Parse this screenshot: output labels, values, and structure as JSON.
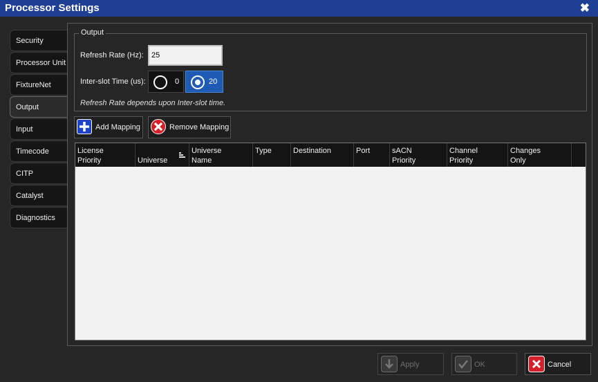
{
  "window": {
    "title": "Processor Settings",
    "close_glyph": "✖"
  },
  "sidebar": {
    "items": [
      {
        "label": "Security"
      },
      {
        "label": "Processor Unit"
      },
      {
        "label": "FixtureNet"
      },
      {
        "label": "Output",
        "active": true
      },
      {
        "label": "Input"
      },
      {
        "label": "Timecode"
      },
      {
        "label": "CITP"
      },
      {
        "label": "Catalyst"
      },
      {
        "label": "Diagnostics"
      }
    ]
  },
  "output": {
    "group_title": "Output",
    "refresh_rate_label": "Refresh Rate (Hz):",
    "refresh_rate_value": "25",
    "interslot_label": "Inter-slot Time (us):",
    "interslot_options": [
      {
        "value": "0",
        "selected": false
      },
      {
        "value": "20",
        "selected": true
      }
    ],
    "note": "Refresh Rate depends upon Inter-slot time."
  },
  "toolbar": {
    "add_mapping": "Add Mapping",
    "remove_mapping": "Remove Mapping"
  },
  "table": {
    "columns": [
      "License\nPriority",
      "Universe",
      "Universe\nName",
      "Type",
      "Destination",
      "Port",
      "sACN\nPriority",
      "Channel\nPriority",
      "Changes\nOnly"
    ],
    "sorted_column": "Universe",
    "rows": []
  },
  "footer": {
    "apply": "Apply",
    "ok": "OK",
    "cancel": "Cancel"
  },
  "colors": {
    "titlebar": "#1f3f94",
    "selected_radio": "#1e5bb4",
    "add_icon": "#1d44c5",
    "remove_icon": "#d51f2a"
  }
}
